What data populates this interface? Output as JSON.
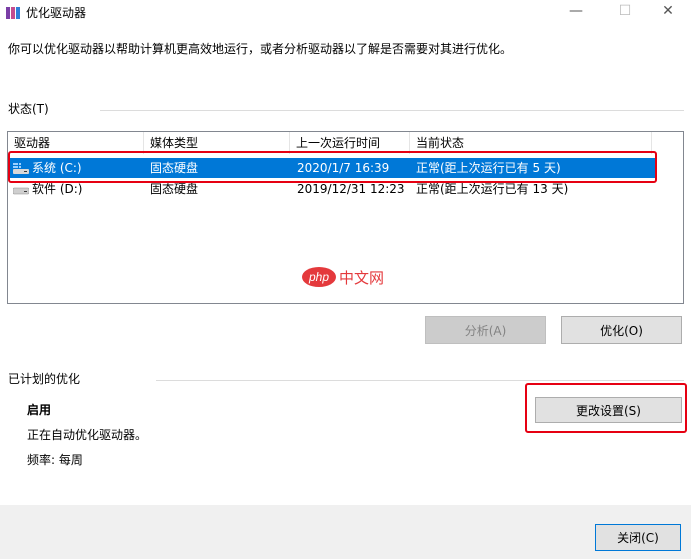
{
  "window": {
    "title": "优化驱动器",
    "min_glyph": "—",
    "max_glyph": "☐",
    "close_glyph": "✕"
  },
  "description": "你可以优化驱动器以帮助计算机更高效地运行，或者分析驱动器以了解是否需要对其进行优化。",
  "status": {
    "label": "状态(T)",
    "columns": [
      "驱动器",
      "媒体类型",
      "上一次运行时间",
      "当前状态"
    ],
    "rows": [
      {
        "drive": "系统 (C:)",
        "media": "固态硬盘",
        "last_run": "2020/1/7 16:39",
        "status": "正常(距上次运行已有 5 天)",
        "selected": true
      },
      {
        "drive": "软件 (D:)",
        "media": "固态硬盘",
        "last_run": "2019/12/31 12:23",
        "status": "正常(距上次运行已有 13 天)",
        "selected": false
      }
    ]
  },
  "buttons": {
    "analyze": "分析(A)",
    "optimize": "优化(O)",
    "change_settings": "更改设置(S)",
    "close": "关闭(C)"
  },
  "scheduled": {
    "label": "已计划的优化",
    "state": "启用",
    "info": "正在自动优化驱动器。",
    "frequency": "频率: 每周"
  },
  "watermark": {
    "logo_text": "php",
    "site_text": "中文网"
  },
  "colors": {
    "selection": "#0078d7",
    "highlight_border": "#e60012",
    "watermark_logo": "#e4393c"
  }
}
